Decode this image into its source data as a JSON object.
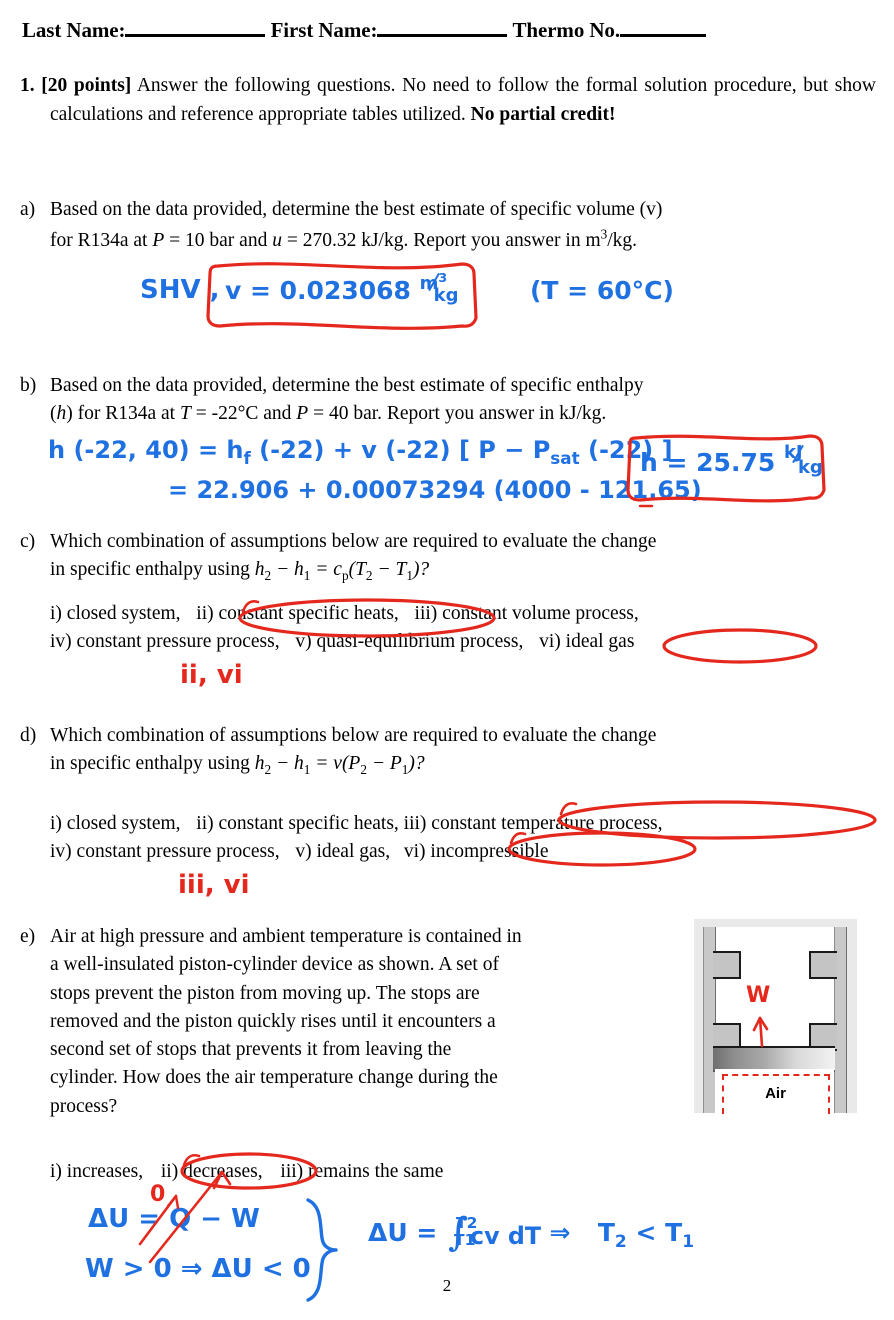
{
  "document": {
    "page_number": "2"
  },
  "header": {
    "last_name_label": "Last Name:",
    "first_name_label": "First Name:",
    "thermo_no_label": "Thermo No.",
    "last_name_value": "",
    "first_name_value": "",
    "thermo_no_value": ""
  },
  "question1": {
    "number": "1.",
    "points": "[20 points]",
    "stem": "Answer the following questions.  No need to follow the formal solution procedure, but show calculations and reference appropriate tables utilized.",
    "emphasis": "No partial credit!"
  },
  "parts": {
    "a": {
      "label": "a)",
      "line1": "Based on the data provided, determine the best estimate of specific volume (v)",
      "line2_pre": "for R134a at ",
      "line2_P": "P",
      "line2_mid": " = 10 bar and ",
      "line2_u": "u",
      "line2_post": " = 270.32 kJ/kg. Report you answer in m",
      "line2_exp": "3",
      "line2_end": "/kg.",
      "handwriting": {
        "note": "SHV ,",
        "boxed_answer": "v = 0.023068",
        "boxed_units_num": "m3",
        "boxed_units_den": "kg",
        "side_note": "(T = 60°C)"
      }
    },
    "b": {
      "label": "b)",
      "line1": "Based on the data provided, determine the best estimate of specific enthalpy",
      "line2_pre": "(",
      "line2_h": "h",
      "line2_mid1": ") for R134a at ",
      "line2_T": "T",
      "line2_mid2": " = -22°C and ",
      "line2_P": "P",
      "line2_post": " = 40 bar.  Report you answer in kJ/kg.",
      "handwriting": {
        "eq_line1": "h (-22, 40) = h_f (-22) + v (-22) [ P - P_sat (-22) ]",
        "eq_line2": "= 22.906 + 0.00073294 (4000 - 121.65)",
        "boxed_answer": "h = 25.75",
        "boxed_units_num": "kJ",
        "boxed_units_den": "kg"
      }
    },
    "c": {
      "label": "c)",
      "line1": "Which combination of assumptions below are required to evaluate the change",
      "line2_pre": "in specific enthalpy using ",
      "equation": "h2 - h1 = cp(T2 - T1)?",
      "options_line1": [
        {
          "text": "i) closed system,",
          "circled": false
        },
        {
          "text": "ii) constant specific heats,",
          "circled": true
        },
        {
          "text": "iii) constant volume process,",
          "circled": false
        }
      ],
      "options_line2": [
        {
          "text": "iv) constant pressure process,",
          "circled": false
        },
        {
          "text": "v) quasi-equilibrium process,",
          "circled": false
        },
        {
          "text": "vi) ideal gas",
          "circled": true
        }
      ],
      "handwritten_answer": "ii, vi"
    },
    "d": {
      "label": "d)",
      "line1": "Which combination of assumptions below are required to evaluate the change",
      "line2_pre": "in specific enthalpy using ",
      "equation": "h2 - h1 = v(P2 - P1)?",
      "options_line1": [
        {
          "text": "i) closed system,",
          "circled": false
        },
        {
          "text": "ii) constant specific heats,",
          "circled": false
        },
        {
          "text": "iii) constant temperature process,",
          "circled": true
        }
      ],
      "options_line2": [
        {
          "text": "iv) constant pressure process,",
          "circled": false
        },
        {
          "text": "v) ideal gas,",
          "circled": false
        },
        {
          "text": "vi) incompressible",
          "circled": true
        }
      ],
      "handwritten_answer": "iii, vi"
    },
    "e": {
      "label": "e)",
      "lines": [
        "Air at high pressure and ambient temperature is contained in",
        "a well-insulated piston-cylinder device as shown.  A set of",
        "stops prevent the piston from moving up.  The stops are",
        "removed and the piston quickly rises until it encounters a",
        "second set of stops that prevents it from leaving the",
        "cylinder.  How does the air temperature change during the",
        "process?"
      ],
      "options": [
        {
          "text": "i) increases,",
          "circled": false
        },
        {
          "text": "ii) decreases,",
          "circled": true
        },
        {
          "text": "iii) remains the same",
          "circled": false
        }
      ],
      "figure": {
        "air_label": "Air",
        "work_label": "W"
      },
      "handwriting": {
        "eq1": "ΔU = Q - W",
        "eq1_strike_note": "0",
        "eq2": "W > 0  ⇒  ΔU < 0",
        "eq3_lhs": "ΔU =",
        "eq3_integral_upper": "T2",
        "eq3_integral_lower": "T1",
        "eq3_integrand": "cv dT",
        "eq3_arrow": "⇒",
        "eq3_result": "T2 < T1"
      }
    }
  },
  "colors": {
    "ink_blue": "#1f70e0",
    "ink_red": "#e5281d",
    "text_black": "#000000",
    "figure_bg": "#e9e9e9"
  }
}
